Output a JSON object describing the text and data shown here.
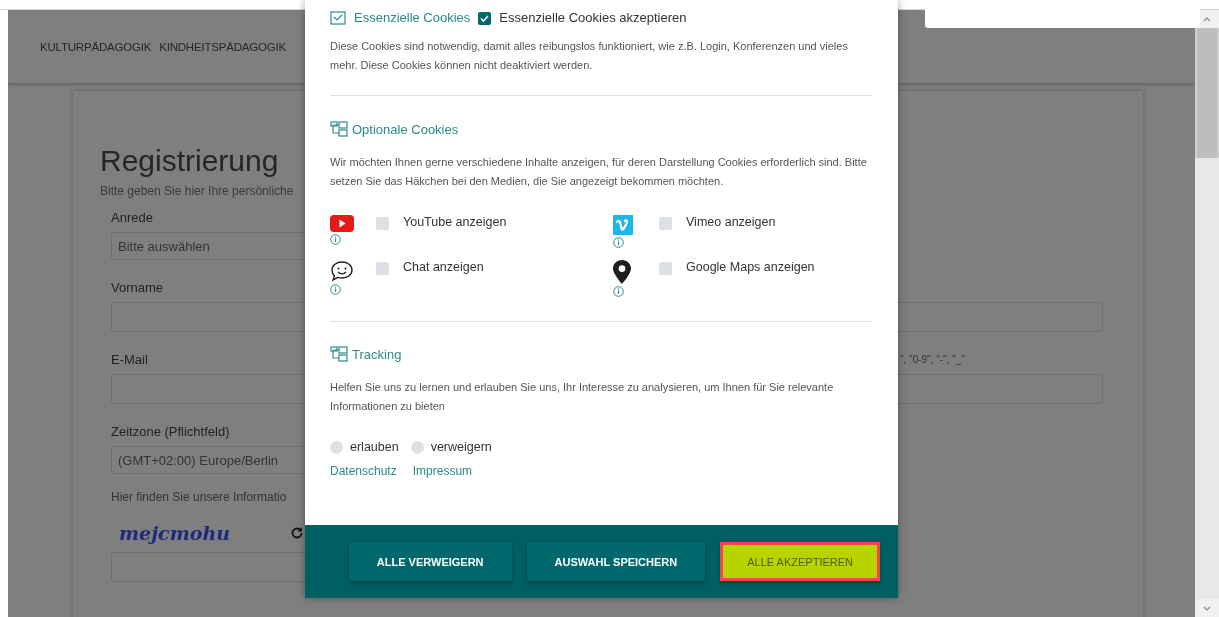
{
  "nav": {
    "items": [
      "KULTURPÄDAGOGIK",
      "KINDHEITSPÄDAGOGIK"
    ]
  },
  "registration": {
    "title": "Registrierung",
    "subtitle": "Bitte geben Sie hier Ihre persönliche",
    "fields": [
      {
        "kind": "select",
        "label": "Anrede",
        "value": "Bitte auswählen"
      },
      {
        "kind": "input",
        "label": "Vorname"
      },
      {
        "kind": "input",
        "label": "E-Mail",
        "hint": "\", \"0-9\", \"-\", \"_\""
      },
      {
        "kind": "select",
        "label": "Zeitzone (Pflichtfeld)",
        "value": "(GMT+02:00) Europe/Berlin"
      }
    ],
    "info_text": "Hier finden Sie unsere Informatio",
    "captcha": "mejcmohu"
  },
  "cookie_dialog": {
    "essential": {
      "title": "Essenzielle Cookies",
      "accept_label": "Essenzielle Cookies akzeptieren",
      "checked": true,
      "text": "Diese Cookies sind notwendig, damit alles reibungslos funktioniert, wie z.B. Login, Konferenzen und vieles mehr. Diese Cookies können nicht deaktiviert werden."
    },
    "optional": {
      "title": "Optionale Cookies",
      "text": "Wir möchten Ihnen gerne verschiedene Inhalte anzeigen, für deren Darstellung Cookies erforderlich sind. Bitte setzen Sie das Häkchen bei den Medien, die Sie angezeigt bekommen möchten.",
      "services": [
        {
          "kind": "youtube",
          "label": "YouTube anzeigen",
          "checked": false
        },
        {
          "kind": "vimeo",
          "label": "Vimeo anzeigen",
          "checked": false
        },
        {
          "kind": "chat",
          "label": "Chat anzeigen",
          "checked": false
        },
        {
          "kind": "maps",
          "label": "Google Maps anzeigen",
          "checked": false
        }
      ]
    },
    "tracking": {
      "title": "Tracking",
      "text": "Helfen Sie uns zu lernen und erlauben Sie uns, Ihr Interesse zu analysieren, um Ihnen für Sie relevante Informationen zu bieten",
      "options": [
        {
          "label": "erlauben",
          "selected": false
        },
        {
          "label": "verweigern",
          "selected": false
        }
      ]
    },
    "links": [
      "Datenschutz",
      "Impressum"
    ],
    "buttons": [
      {
        "kind": "secondary",
        "label": "ALLE VERWEIGERN"
      },
      {
        "kind": "secondary",
        "label": "AUSWAHL SPEICHERN"
      },
      {
        "kind": "primary",
        "label": "ALLE AKZEPTIEREN"
      }
    ]
  }
}
